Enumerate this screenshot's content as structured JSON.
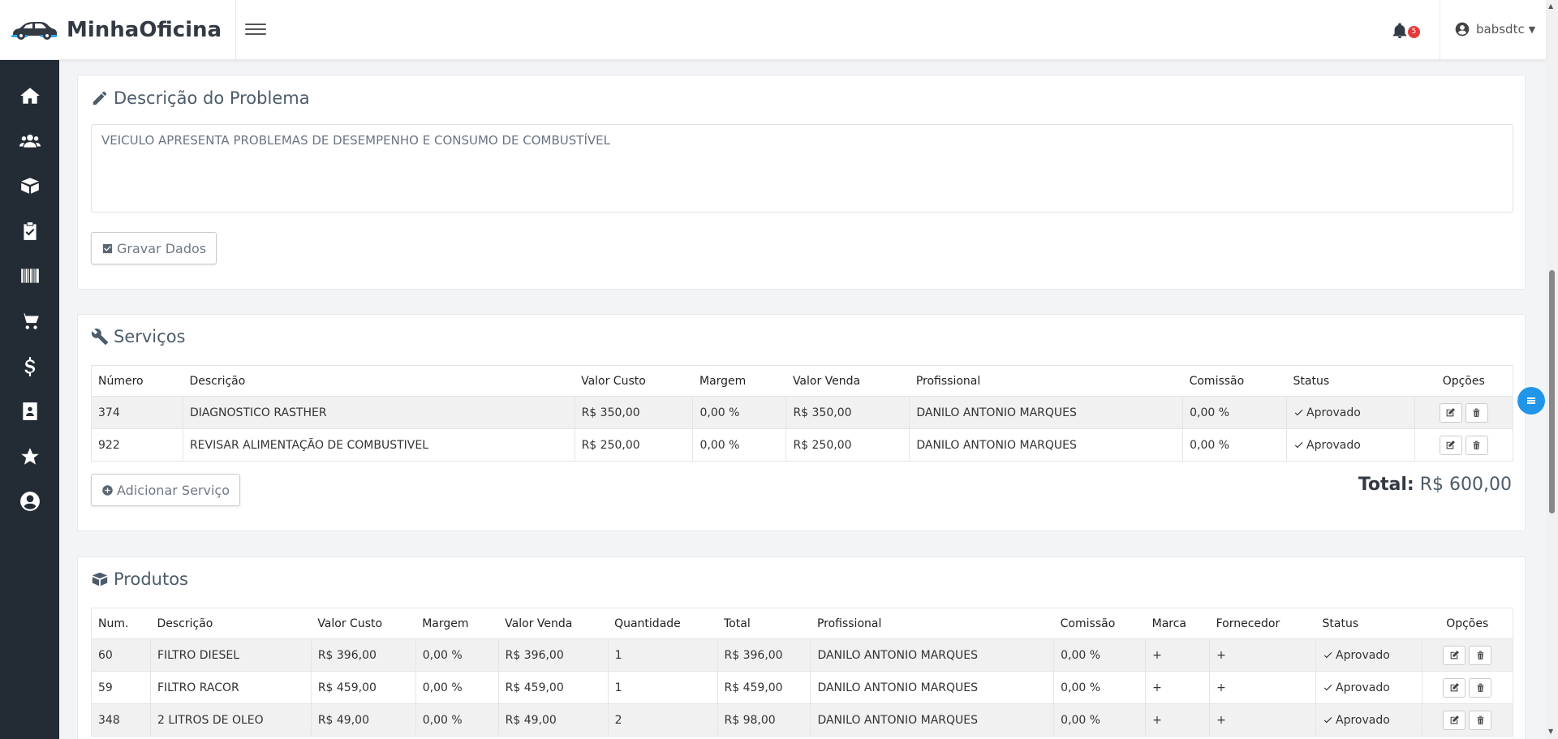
{
  "app": {
    "name": "MinhaOficina"
  },
  "header": {
    "notifications_count": "5",
    "username": "babsdtc"
  },
  "sidebar": {
    "items": [
      {
        "icon": "home-icon"
      },
      {
        "icon": "users-icon"
      },
      {
        "icon": "box-icon"
      },
      {
        "icon": "clipboard-check-icon"
      },
      {
        "icon": "barcode-icon"
      },
      {
        "icon": "cart-icon"
      },
      {
        "icon": "dollar-icon"
      },
      {
        "icon": "contact-book-icon"
      },
      {
        "icon": "star-icon"
      },
      {
        "icon": "user-circle-icon"
      }
    ]
  },
  "problem": {
    "title": "Descrição do Problema",
    "text": "VEICULO APRESENTA PROBLEMAS DE DESEMPENHO E CONSUMO DE COMBUSTÍVEL",
    "save_label": "Gravar Dados"
  },
  "services": {
    "title": "Serviços",
    "columns": [
      "Número",
      "Descrição",
      "Valor Custo",
      "Margem",
      "Valor Venda",
      "Profissional",
      "Comissão",
      "Status",
      "Opções"
    ],
    "rows": [
      {
        "numero": "374",
        "descricao": "DIAGNOSTICO RASTHER",
        "custo": "R$ 350,00",
        "margem": "0,00 %",
        "venda": "R$ 350,00",
        "profissional": "DANILO ANTONIO MARQUES",
        "comissao": "0,00 %",
        "status": "Aprovado"
      },
      {
        "numero": "922",
        "descricao": "REVISAR ALIMENTAÇÃO DE COMBUSTIVEL",
        "custo": "R$ 250,00",
        "margem": "0,00 %",
        "venda": "R$ 250,00",
        "profissional": "DANILO ANTONIO MARQUES",
        "comissao": "0,00 %",
        "status": "Aprovado"
      }
    ],
    "add_label": "Adicionar Serviço",
    "total_label": "Total:",
    "total_value": "R$ 600,00"
  },
  "products": {
    "title": "Produtos",
    "columns": [
      "Num.",
      "Descrição",
      "Valor Custo",
      "Margem",
      "Valor Venda",
      "Quantidade",
      "Total",
      "Profissional",
      "Comissão",
      "Marca",
      "Fornecedor",
      "Status",
      "Opções"
    ],
    "rows": [
      {
        "num": "60",
        "descricao": "FILTRO DIESEL",
        "custo": "R$ 396,00",
        "margem": "0,00 %",
        "venda": "R$ 396,00",
        "quantidade": "1",
        "total": "R$ 396,00",
        "profissional": "DANILO ANTONIO MARQUES",
        "comissao": "0,00 %",
        "marca": "+",
        "fornecedor": "+",
        "status": "Aprovado"
      },
      {
        "num": "59",
        "descricao": "FILTRO RACOR",
        "custo": "R$ 459,00",
        "margem": "0,00 %",
        "venda": "R$ 459,00",
        "quantidade": "1",
        "total": "R$ 459,00",
        "profissional": "DANILO ANTONIO MARQUES",
        "comissao": "0,00 %",
        "marca": "+",
        "fornecedor": "+",
        "status": "Aprovado"
      },
      {
        "num": "348",
        "descricao": "2 LITROS DE OLEO",
        "custo": "R$ 49,00",
        "margem": "0,00 %",
        "venda": "R$ 49,00",
        "quantidade": "2",
        "total": "R$ 98,00",
        "profissional": "DANILO ANTONIO MARQUES",
        "comissao": "0,00 %",
        "marca": "+",
        "fornecedor": "+",
        "status": "Aprovado"
      }
    ]
  }
}
